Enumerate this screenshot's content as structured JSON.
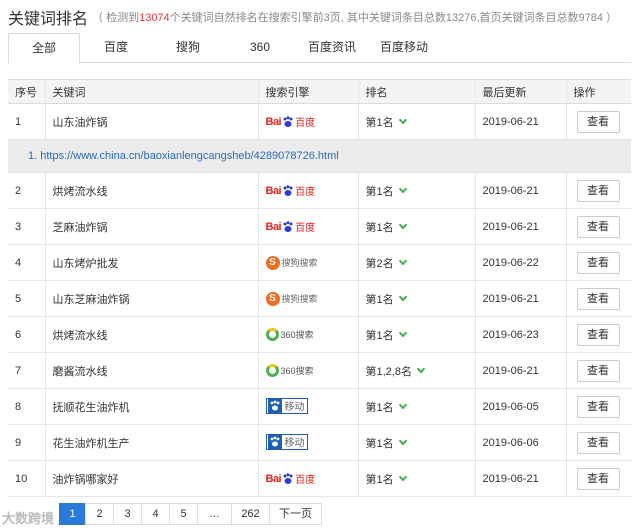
{
  "header": {
    "title": "关键词排名",
    "summary_prefix": "（ 检测到",
    "detected_count": "13074",
    "summary_suffix": "个关键词自然排名在搜索引擎前3页, 其中关键词条目总数13276,首页关键词条目总数9784 ）"
  },
  "tabs": [
    {
      "label": "全部"
    },
    {
      "label": "百度"
    },
    {
      "label": "搜狗"
    },
    {
      "label": "360"
    },
    {
      "label": "百度资讯"
    },
    {
      "label": "百度移动"
    }
  ],
  "table": {
    "headers": [
      "序号",
      "关键词",
      "搜索引擎",
      "排名",
      "最后更新",
      "操作"
    ],
    "view_label": "查看",
    "expanded": {
      "index": "1.",
      "url": "https://www.china.cn/baoxianlengcangsheb/4289078726.html"
    },
    "rows": [
      {
        "no": "1",
        "keyword": "山东油炸锅",
        "engine": "baidu",
        "rank": "第1名",
        "date": "2019-06-21"
      },
      {
        "no": "2",
        "keyword": "烘烤流水线",
        "engine": "baidu",
        "rank": "第1名",
        "date": "2019-06-21"
      },
      {
        "no": "3",
        "keyword": "芝麻油炸锅",
        "engine": "baidu",
        "rank": "第1名",
        "date": "2019-06-21"
      },
      {
        "no": "4",
        "keyword": "山东烤炉批发",
        "engine": "sogou",
        "rank": "第2名",
        "date": "2019-06-22"
      },
      {
        "no": "5",
        "keyword": "山东芝麻油炸锅",
        "engine": "sogou",
        "rank": "第1名",
        "date": "2019-06-21"
      },
      {
        "no": "6",
        "keyword": "烘烤流水线",
        "engine": "360",
        "rank": "第1名",
        "date": "2019-06-23"
      },
      {
        "no": "7",
        "keyword": "磨酱流水线",
        "engine": "360",
        "rank": "第1,2,8名",
        "date": "2019-06-21"
      },
      {
        "no": "8",
        "keyword": "抚顺花生油炸机",
        "engine": "baidu-mobile",
        "rank": "第1名",
        "date": "2019-06-05"
      },
      {
        "no": "9",
        "keyword": "花生油炸机生产",
        "engine": "baidu-mobile",
        "rank": "第1名",
        "date": "2019-06-06"
      },
      {
        "no": "10",
        "keyword": "油炸锅哪家好",
        "engine": "baidu",
        "rank": "第1名",
        "date": "2019-06-21"
      }
    ]
  },
  "logos": {
    "baidu": {
      "bai": "Bai",
      "du": "百度"
    },
    "sogou": {
      "s": "S",
      "txt": "搜狗搜索"
    },
    "360": {
      "txt": "360搜索"
    },
    "baidu-mobile": {
      "txt": "移动"
    }
  },
  "pager": {
    "pages": [
      "1",
      "2",
      "3",
      "4",
      "5",
      "…",
      "262",
      "下一页"
    ],
    "active": "1"
  },
  "watermark": "大数跨境",
  "colors": {
    "accent": "#2a7ad8",
    "highlight": "#e4393c",
    "rank_chevron": "#3fae49",
    "link": "#2a6bbf"
  }
}
